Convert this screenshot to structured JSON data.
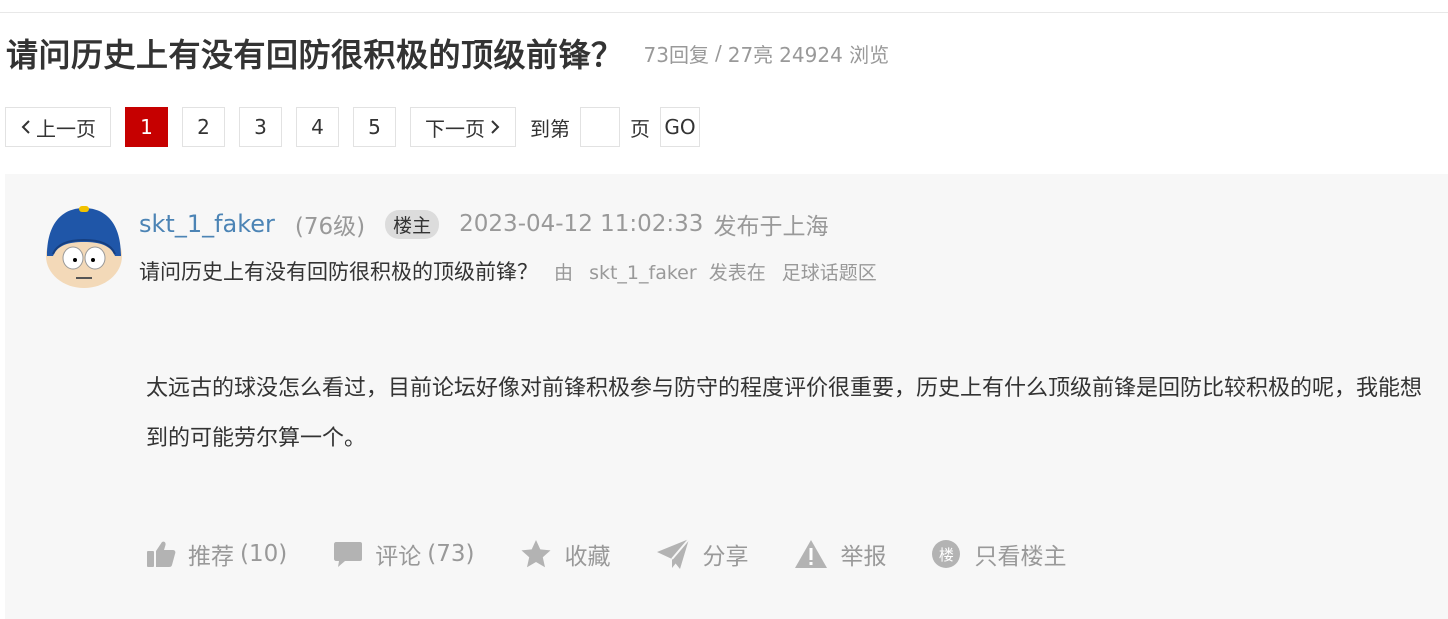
{
  "thread": {
    "title": "请问历史上有没有回防很积极的顶级前锋？",
    "replies": "73回复",
    "separator": "/",
    "likes": "27亮",
    "views": "24924 浏览"
  },
  "pagination": {
    "prev_label": "上一页",
    "pages": [
      "1",
      "2",
      "3",
      "4",
      "5"
    ],
    "current_page": "1",
    "next_label": "下一页",
    "goto_label": "到第",
    "page_input_value": "",
    "page_unit": "页",
    "go_label": "GO",
    "active_color": "#c60000"
  },
  "post": {
    "username": "skt_1_faker",
    "level": "(76级)",
    "badge": "楼主",
    "time": "2023-04-12 11:02:33",
    "location": "发布于上海",
    "subtitle": "请问历史上有没有回防很积极的顶级前锋？",
    "by_label": "由",
    "author": "skt_1_faker",
    "posted_in_label": "发表在",
    "forum": "足球话题区",
    "content": "太远古的球没怎么看过，目前论坛好像对前锋积极参与防守的程度评价很重要，历史上有什么顶级前锋是回防比较积极的呢，我能想到的可能劳尔算一个。"
  },
  "actions": {
    "recommend_label": "推荐",
    "recommend_count": "(10)",
    "comment_label": "评论",
    "comment_count": "(73)",
    "favorite_label": "收藏",
    "share_label": "分享",
    "report_label": "举报",
    "op_only_label": "只看楼主",
    "op_icon_char": "楼"
  },
  "icons": [
    "thumbs-up-icon",
    "comment-icon",
    "star-icon",
    "share-icon",
    "warning-icon",
    "op-badge-icon",
    "chevron-left-icon",
    "chevron-right-icon"
  ],
  "colors": {
    "username": "#4c84b5",
    "muted": "#999999",
    "panel_bg": "#f7f7f7"
  }
}
